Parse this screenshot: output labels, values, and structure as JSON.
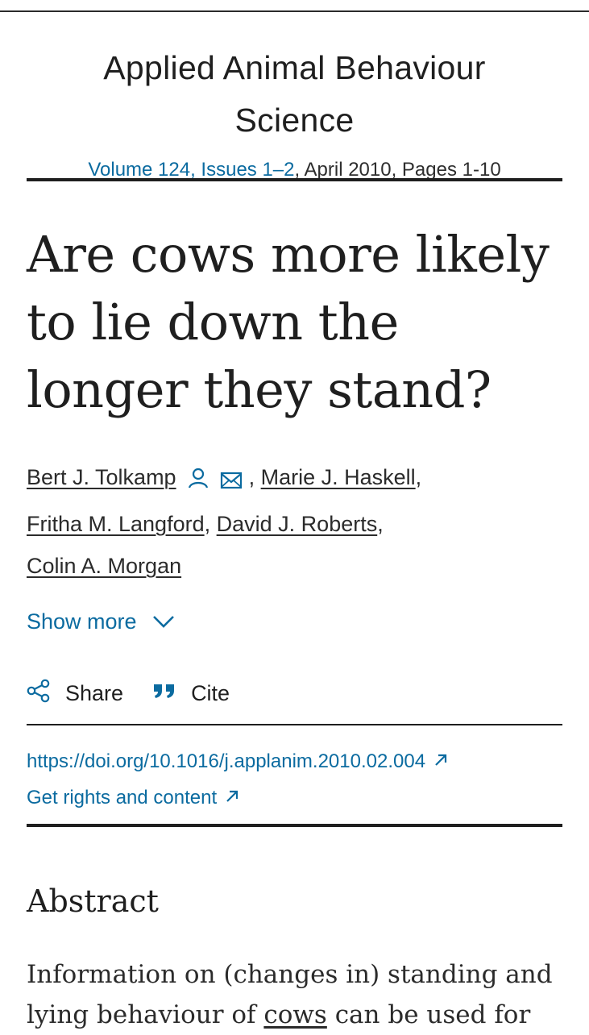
{
  "journal": {
    "title_line1": "Applied Animal Behaviour",
    "title_line2": "Science",
    "issue_link": "Volume 124, Issues 1–2",
    "issue_rest": ", April 2010, Pages 1-10"
  },
  "article": {
    "title": "Are cows more likely to lie down the longer they stand?"
  },
  "authors": [
    {
      "name": "Bert J. Tolkamp"
    },
    {
      "name": "Marie J. Haskell"
    },
    {
      "name": "Fritha M. Langford"
    },
    {
      "name": "David J. Roberts"
    },
    {
      "name": "Colin A. Morgan"
    }
  ],
  "author_separators": {
    "comma": ","
  },
  "icons": [
    "person-icon",
    "envelope-icon",
    "chevron-down-icon",
    "share-icon",
    "quote-icon",
    "external-link-icon"
  ],
  "show_more": {
    "label": "Show more"
  },
  "actions": {
    "share_label": "Share",
    "cite_label": "Cite"
  },
  "links": {
    "doi": "https://doi.org/10.1016/j.applanim.2010.02.004",
    "rights": "Get rights and content"
  },
  "abstract": {
    "heading": "Abstract",
    "text_part1": "Information on (changes in) standing and lying behaviour of ",
    "text_link": "cows",
    "text_part2": " can be used for"
  },
  "colors": {
    "link": "#0b6ba0",
    "text": "#1f1f1f"
  }
}
